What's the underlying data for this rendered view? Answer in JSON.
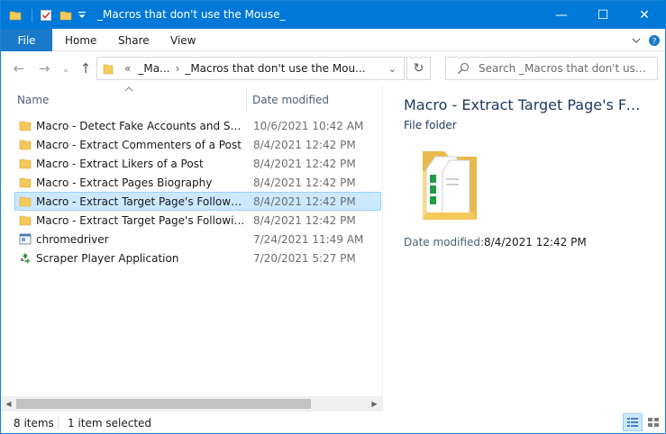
{
  "window": {
    "title": "_Macros that don't use the Mouse_",
    "controls": {
      "minimize": "—",
      "maximize": "☐",
      "close": "✕"
    }
  },
  "quick_access": [
    {
      "icon": "folder-icon"
    },
    {
      "icon": "properties-check-icon"
    },
    {
      "icon": "new-folder-icon"
    },
    {
      "icon": "customize-dropdown-icon"
    }
  ],
  "ribbon": {
    "tabs": [
      "File",
      "Home",
      "Share",
      "View"
    ],
    "expand_icon": "chevron-down-icon",
    "help_icon": "help-icon"
  },
  "navigation": {
    "back": "←",
    "forward": "→",
    "recent": "⌄",
    "up": "↑",
    "overflow": "«",
    "breadcrumb": [
      "_Ma...",
      "_Macros that don't use the Mou..."
    ],
    "breadcrumb_sep": "›",
    "dropdown": "⌄",
    "refresh": "↻"
  },
  "search": {
    "placeholder": "Search _Macros that don't use the _..."
  },
  "columns": {
    "name": "Name",
    "date_modified": "Date modified"
  },
  "files": [
    {
      "name": "Macro - Detect Fake Accounts and Scrap...",
      "date": "10/6/2021 10:42 AM",
      "type": "folder",
      "selected": false
    },
    {
      "name": "Macro - Extract Commenters of a Post",
      "date": "8/4/2021 12:42 PM",
      "type": "folder",
      "selected": false
    },
    {
      "name": "Macro - Extract Likers of a Post",
      "date": "8/4/2021 12:42 PM",
      "type": "folder",
      "selected": false
    },
    {
      "name": "Macro - Extract Pages Biography",
      "date": "8/4/2021 12:42 PM",
      "type": "folder",
      "selected": false
    },
    {
      "name": "Macro - Extract Target Page's Followers",
      "date": "8/4/2021 12:42 PM",
      "type": "folder",
      "selected": true
    },
    {
      "name": "Macro - Extract Target Page's Followings",
      "date": "8/4/2021 12:42 PM",
      "type": "folder",
      "selected": false
    },
    {
      "name": "chromedriver",
      "date": "7/24/2021 11:49 AM",
      "type": "application",
      "selected": false
    },
    {
      "name": "Scraper Player Application",
      "date": "7/20/2021 5:27 PM",
      "type": "app-recycle",
      "selected": false
    }
  ],
  "preview": {
    "title": "Macro - Extract Target Page's Followe...",
    "type": "File folder",
    "meta_label": "Date modified:",
    "meta_value": "8/4/2021 12:42 PM"
  },
  "status": {
    "item_count": "8 items",
    "selection": "1 item selected"
  },
  "colors": {
    "title_bar": "#0078d7",
    "file_tab": "#1979ca",
    "selection": "#cce8ff",
    "selection_border": "#99d1ff",
    "folder": "#e8b84a"
  }
}
